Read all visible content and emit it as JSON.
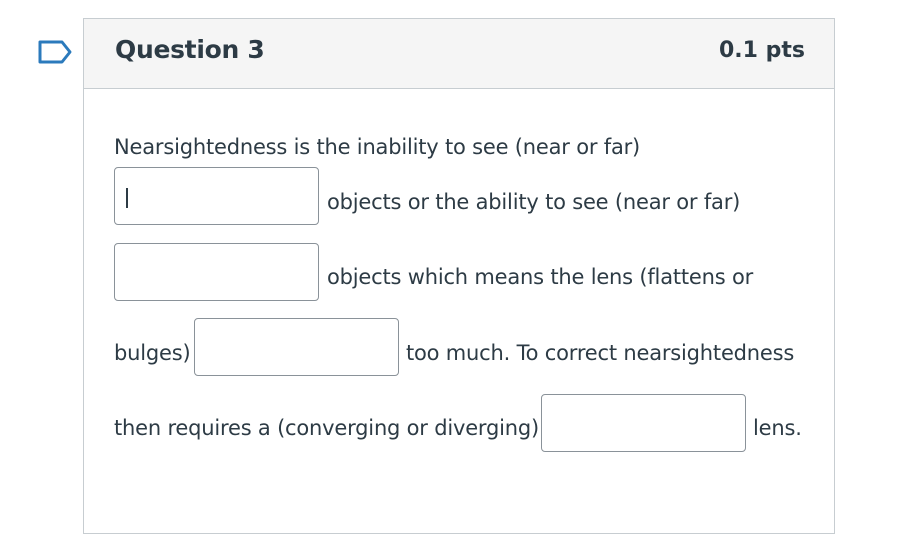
{
  "question": {
    "title": "Question 3",
    "points": "0.1 pts"
  },
  "body": {
    "line1": "Nearsightedness is the inability to see (near or far)",
    "after_blank1": "objects or the ability to see (near or far)",
    "after_blank2": "objects which means the lens (flattens or",
    "before_blank3": "bulges)",
    "after_blank3": "too much. To correct nearsightedness",
    "before_blank4": "then requires a (converging or diverging)",
    "after_blank4": "lens."
  },
  "blanks": [
    "",
    "",
    "",
    ""
  ],
  "icons": {
    "flag": "bookmark-flag-icon"
  },
  "colors": {
    "flag_stroke": "#2b7abc",
    "text": "#2d3b45",
    "border": "#c7cdd1",
    "header_bg": "#f5f5f5"
  }
}
